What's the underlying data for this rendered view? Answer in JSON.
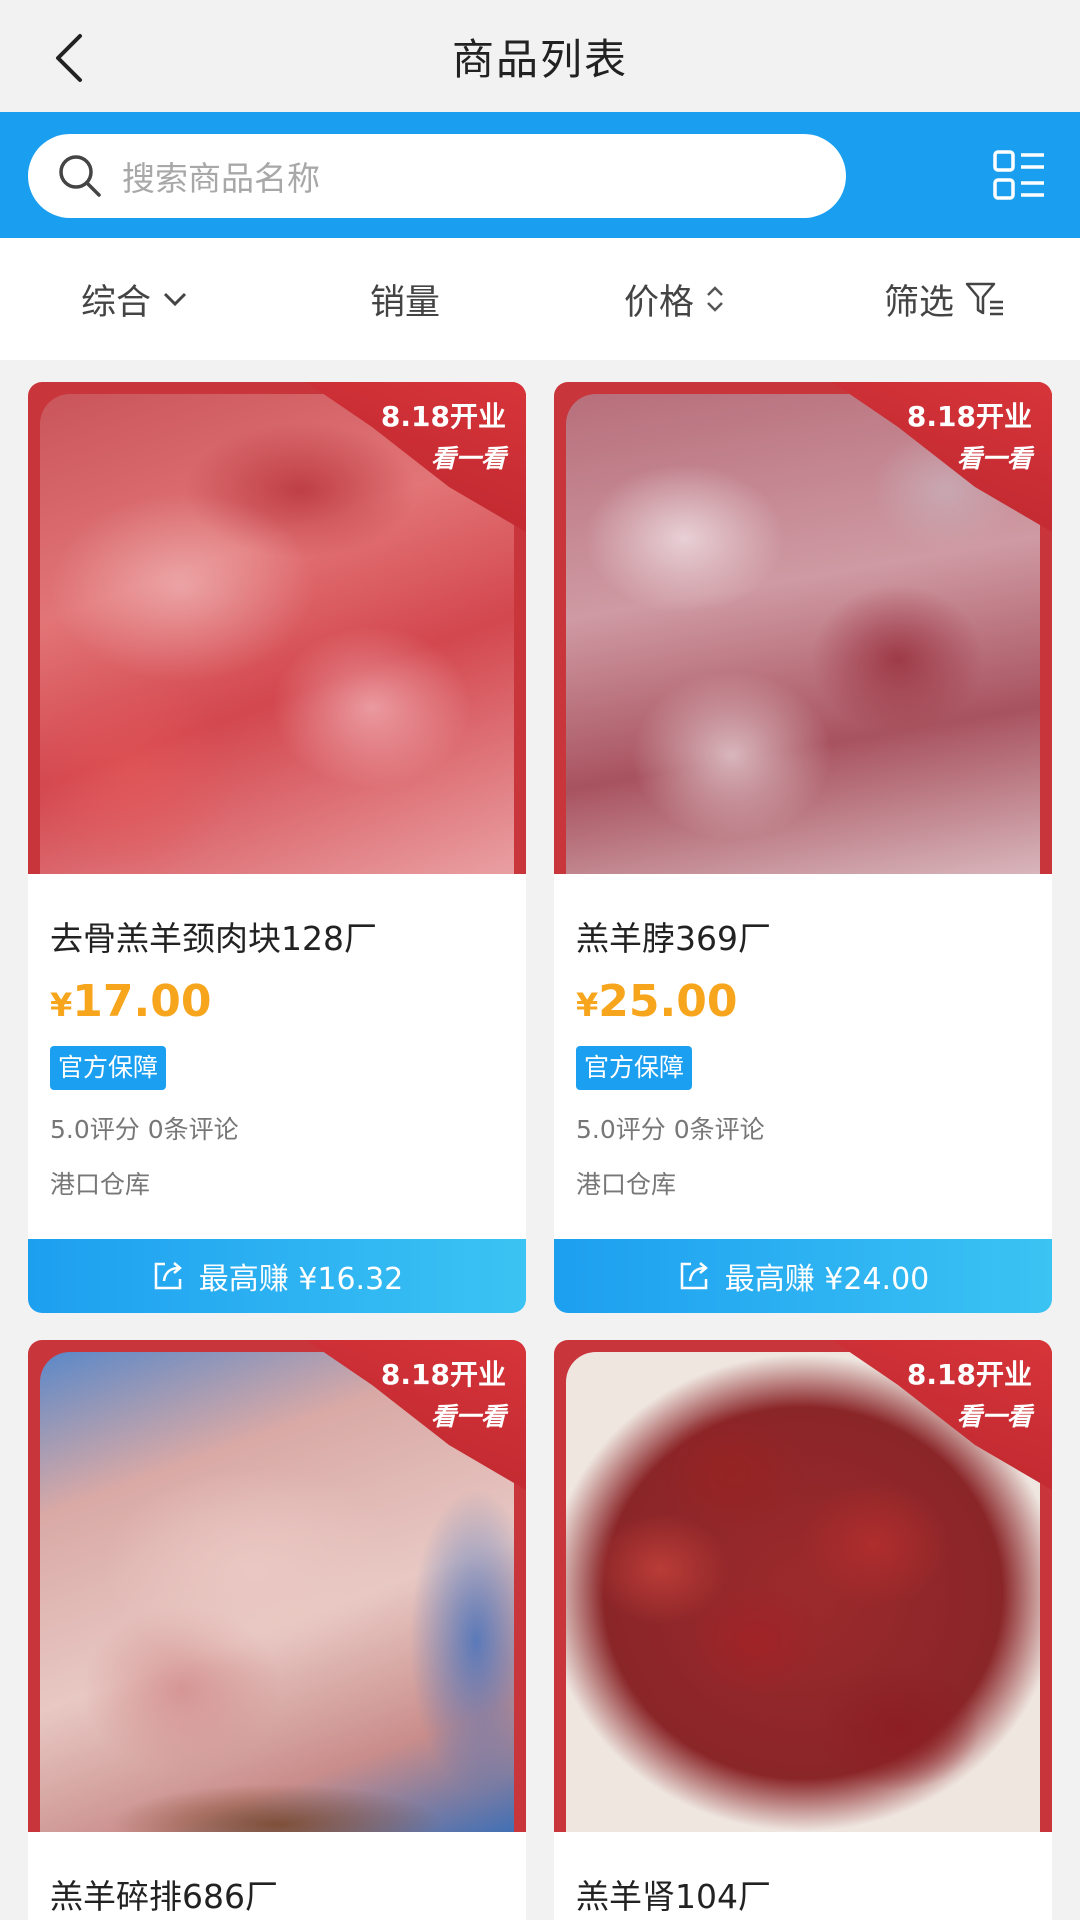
{
  "header": {
    "title": "商品列表"
  },
  "search": {
    "placeholder": "搜索商品名称"
  },
  "sort": {
    "items": [
      {
        "label": "综合",
        "icon": "chevron-down-icon"
      },
      {
        "label": "销量",
        "icon": ""
      },
      {
        "label": "价格",
        "icon": "sort-updown-icon"
      },
      {
        "label": "筛选",
        "icon": "filter-icon"
      }
    ]
  },
  "ribbon": {
    "line1": "8.18开业",
    "line2": "看一看"
  },
  "products": [
    {
      "name": "去骨羔羊颈肉块128厂",
      "currency": "¥",
      "price": "17.00",
      "badge": "官方保障",
      "rating": "5.0评分 0条评论",
      "warehouse": "港口仓库",
      "earn": "最高赚 ¥16.32"
    },
    {
      "name": "羔羊脖369厂",
      "currency": "¥",
      "price": "25.00",
      "badge": "官方保障",
      "rating": "5.0评分 0条评论",
      "warehouse": "港口仓库",
      "earn": "最高赚 ¥24.00"
    },
    {
      "name": "羔羊碎排686厂"
    },
    {
      "name": "羔羊肾104厂"
    }
  ],
  "colors": {
    "brand_blue": "#1a9ff0",
    "price_orange": "#f7a51c",
    "ribbon_red": "#c8353b"
  }
}
